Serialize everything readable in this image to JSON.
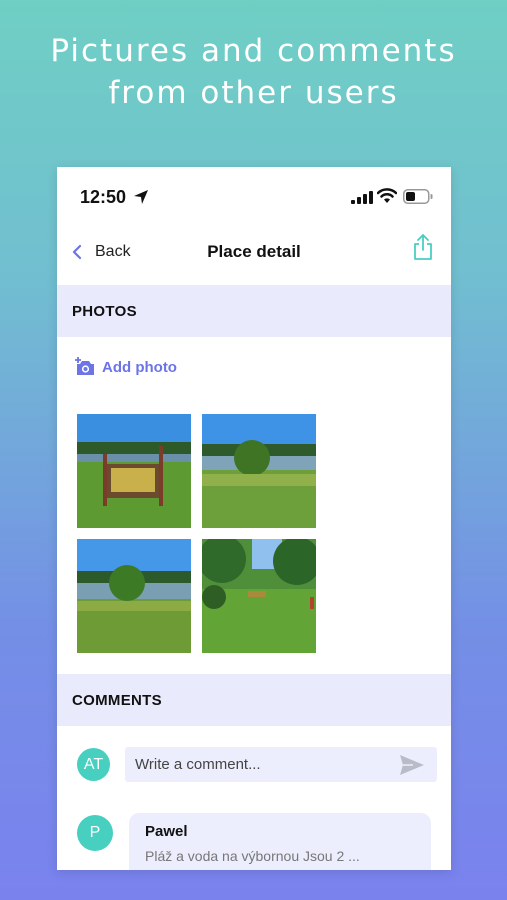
{
  "promo": {
    "headline": "Pictures and comments\nfrom  other users"
  },
  "status_bar": {
    "time": "12:50"
  },
  "nav": {
    "back_label": "Back",
    "title": "Place detail"
  },
  "photos_section": {
    "title": "PHOTOS",
    "add_photo_label": "Add photo",
    "photos": [
      {
        "icon": "photo-sign-lake"
      },
      {
        "icon": "photo-bush-lake"
      },
      {
        "icon": "photo-tree-lake"
      },
      {
        "icon": "photo-meadow-bench"
      }
    ]
  },
  "comments_section": {
    "title": "COMMENTS",
    "current_user_initials": "AT",
    "input_placeholder": "Write a comment...",
    "comments": [
      {
        "avatar_initial": "P",
        "author": "Pawel",
        "text": "Pláž a voda na výbornou Jsou 2 ..."
      }
    ]
  },
  "colors": {
    "accent": "#6c74e6",
    "teal": "#47cfc0",
    "section_bg": "#e9ebfd",
    "bubble_bg": "#eceefd"
  }
}
